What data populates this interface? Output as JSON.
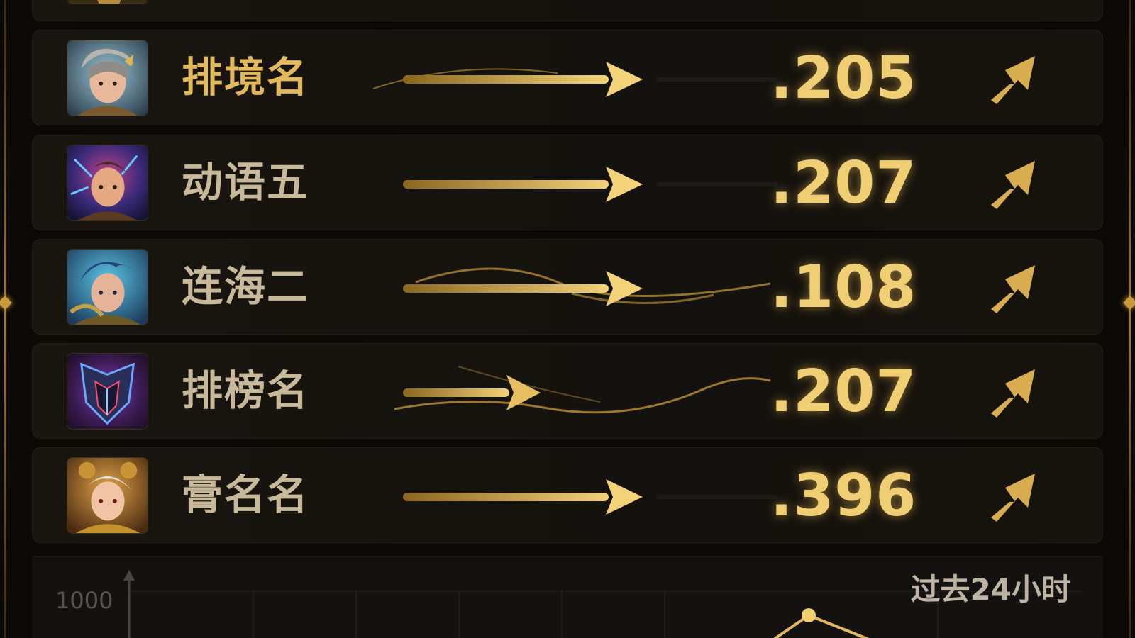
{
  "leaderboard": {
    "rows": [
      {
        "name": "排境名",
        "score": ".205",
        "trend": "up",
        "avatar": "hero-silver-hair",
        "highlight": true
      },
      {
        "name": "动语五",
        "score": ".207",
        "trend": "up",
        "avatar": "hero-lightning",
        "highlight": false
      },
      {
        "name": "连海二",
        "score": ".108",
        "trend": "up",
        "avatar": "hero-blue-hair",
        "highlight": false
      },
      {
        "name": "排榜名",
        "score": ".207",
        "trend": "up",
        "avatar": "emblem-shield",
        "highlight": false
      },
      {
        "name": "膏名名",
        "score": ".396",
        "trend": "up",
        "avatar": "hero-white-hair",
        "highlight": false
      }
    ]
  },
  "chart": {
    "period_label": "过去24小时",
    "y_tick_top": "1000"
  },
  "colors": {
    "gold": "#f0ce73",
    "gold_dim": "#c99b3a",
    "panel": "#14120e"
  }
}
